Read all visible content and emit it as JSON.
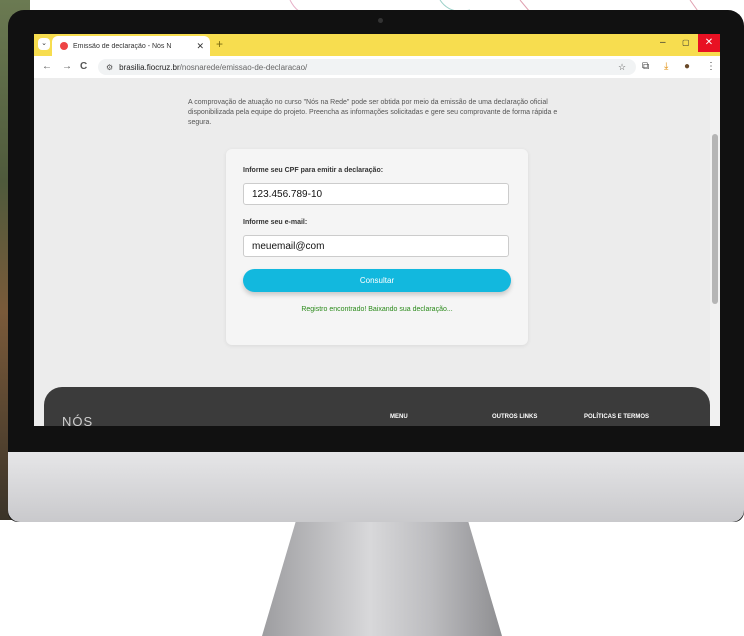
{
  "browser": {
    "tab_title": "Emissão de declaração - Nós N",
    "tab_close": "✕",
    "new_tab": "+",
    "url_host": "brasilia.fiocruz.br",
    "url_path": "/nosnarede/emissao-de-declaracao/",
    "window_min": "–",
    "window_max": "▢",
    "window_close": "✕",
    "back": "←",
    "forward": "→",
    "reload": "C"
  },
  "page": {
    "intro_text": "A comprovação de atuação no curso \"Nós na Rede\" pode ser obtida por meio da emissão de uma declaração oficial disponibilizada pela equipe do projeto. Preencha as informações solicitadas e gere seu comprovante de forma rápida e segura.",
    "form": {
      "cpf_label": "Informe seu CPF para emitir a declaração:",
      "cpf_value": "123.456.789-10",
      "email_label": "Informe seu e-mail:",
      "email_value": "meuemail@com",
      "submit_label": "Consultar",
      "status_message": "Registro encontrado! Baixando sua declaração..."
    }
  },
  "footer": {
    "logo_text": "NÓS",
    "menu_heading": "MENU",
    "links_heading": "OUTROS LINKS",
    "policies_heading": "POLÍTICAS E TERMOS"
  },
  "colors": {
    "tab_strip": "#f7dd4f",
    "button": "#12b8de",
    "success_text": "#2a8a1a",
    "footer_bg": "#3b3b3b"
  }
}
